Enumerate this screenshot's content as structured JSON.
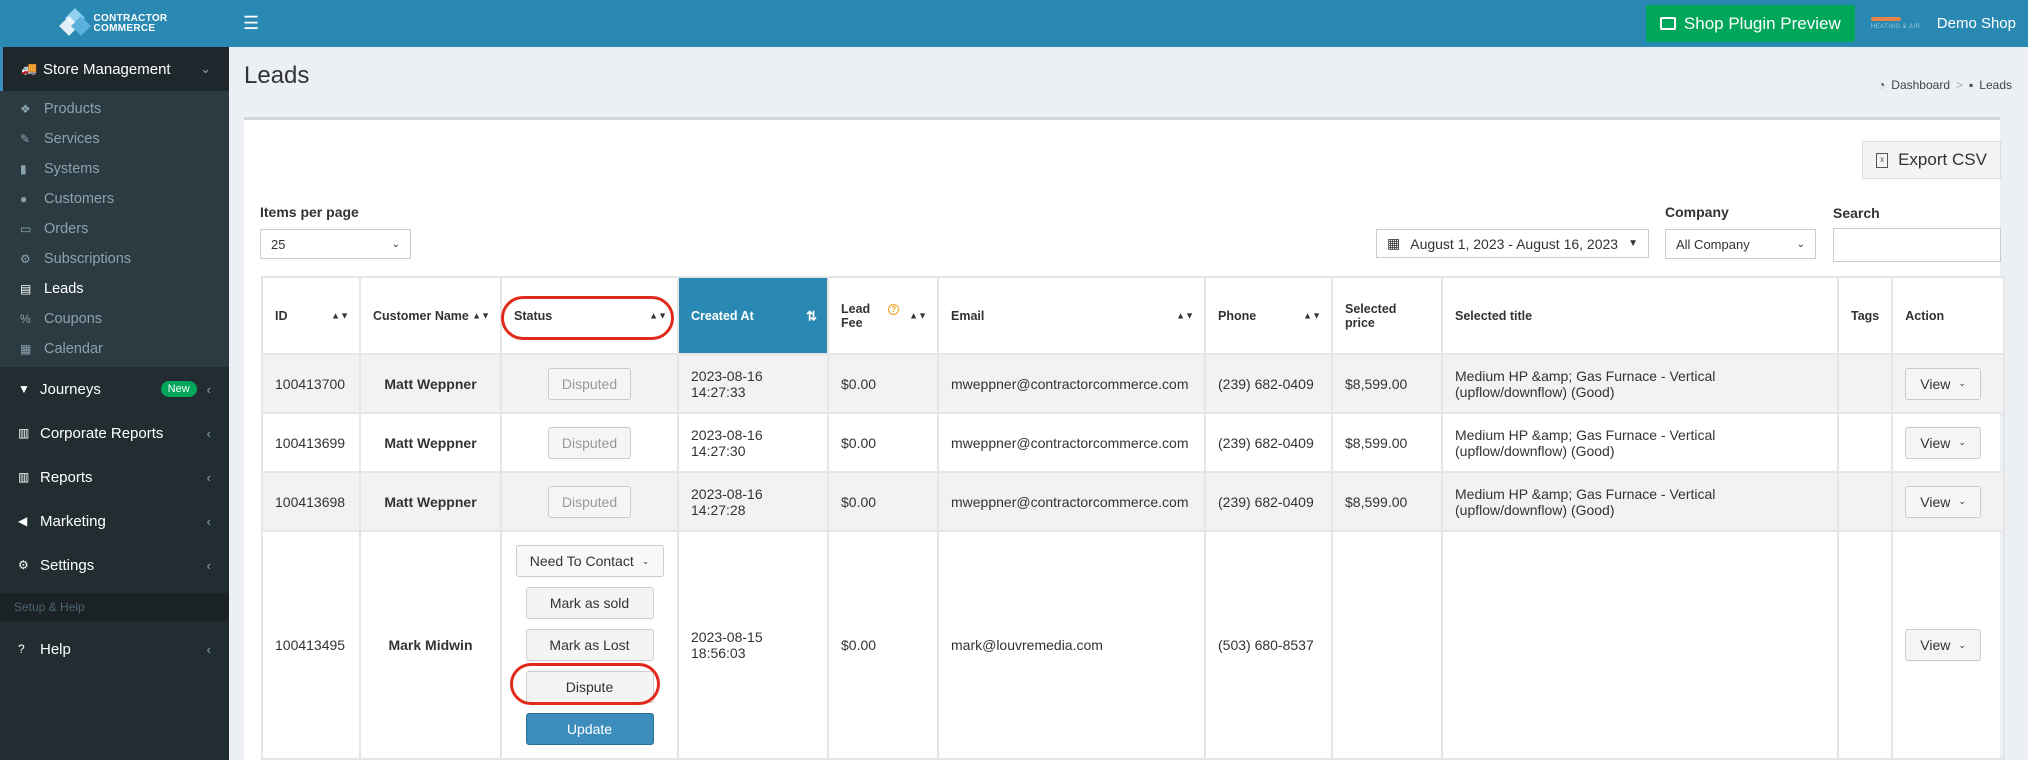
{
  "brand": {
    "line1": "CONTRACTOR",
    "line2": "COMMERCE"
  },
  "sidebar": {
    "store_management": "Store Management",
    "sub_items": [
      {
        "label": "Products",
        "icon": "cubes-icon"
      },
      {
        "label": "Services",
        "icon": "wrench-icon"
      },
      {
        "label": "Systems",
        "icon": "systems-icon"
      },
      {
        "label": "Customers",
        "icon": "users-icon"
      },
      {
        "label": "Orders",
        "icon": "inbox-icon"
      },
      {
        "label": "Subscriptions",
        "icon": "cogs-icon"
      },
      {
        "label": "Leads",
        "icon": "table-icon"
      },
      {
        "label": "Coupons",
        "icon": "percent-icon"
      },
      {
        "label": "Calendar",
        "icon": "calendar-icon"
      }
    ],
    "journeys": "Journeys",
    "journeys_badge": "New",
    "corporate_reports": "Corporate Reports",
    "reports": "Reports",
    "marketing": "Marketing",
    "settings": "Settings",
    "setup_help": "Setup & Help",
    "help": "Help"
  },
  "header": {
    "plugin_button": "Shop Plugin Preview",
    "shop_name": "Demo Shop",
    "logo_text": "HEATING & AIR"
  },
  "page": {
    "title": "Leads",
    "breadcrumb_dashboard": "Dashboard",
    "breadcrumb_current": "Leads"
  },
  "toolbar": {
    "export_label": "Export CSV",
    "items_per_page_label": "Items per page",
    "items_per_page_value": "25",
    "date_range": "August 1, 2023 - August 16, 2023",
    "company_label": "Company",
    "company_value": "All Company",
    "search_label": "Search"
  },
  "table": {
    "headers": {
      "id": "ID",
      "customer_name": "Customer Name",
      "status": "Status",
      "created_at": "Created At",
      "lead_fee_1": "Lead",
      "lead_fee_2": "Fee",
      "email": "Email",
      "phone": "Phone",
      "selected_price": "Selected price",
      "selected_title": "Selected title",
      "tags": "Tags",
      "action": "Action"
    },
    "rows": [
      {
        "id": "100413700",
        "customer": "Matt Weppner",
        "status": "Disputed",
        "date": "2023-08-16",
        "time": "14:27:33",
        "fee": "$0.00",
        "email": "mweppner@contractorcommerce.com",
        "phone": "(239) 682-0409",
        "price": "$8,599.00",
        "title1": "Medium HP &amp; Gas Furnace - Vertical",
        "title2": "(upflow/downflow) (Good)",
        "action": "View"
      },
      {
        "id": "100413699",
        "customer": "Matt Weppner",
        "status": "Disputed",
        "date": "2023-08-16",
        "time": "14:27:30",
        "fee": "$0.00",
        "email": "mweppner@contractorcommerce.com",
        "phone": "(239) 682-0409",
        "price": "$8,599.00",
        "title1": "Medium HP &amp; Gas Furnace - Vertical",
        "title2": "(upflow/downflow) (Good)",
        "action": "View"
      },
      {
        "id": "100413698",
        "customer": "Matt Weppner",
        "status": "Disputed",
        "date": "2023-08-16",
        "time": "14:27:28",
        "fee": "$0.00",
        "email": "mweppner@contractorcommerce.com",
        "phone": "(239) 682-0409",
        "price": "$8,599.00",
        "title1": "Medium HP &amp; Gas Furnace - Vertical",
        "title2": "(upflow/downflow) (Good)",
        "action": "View"
      },
      {
        "id": "100413495",
        "customer": "Mark Midwin",
        "status_select": "Need To Contact",
        "mark_sold": "Mark as sold",
        "mark_lost": "Mark as Lost",
        "dispute": "Dispute",
        "update": "Update",
        "date": "2023-08-15",
        "time": "18:56:03",
        "fee": "$0.00",
        "email": "mark@louvremedia.com",
        "phone": "(503) 680-8537",
        "action": "View"
      }
    ]
  },
  "colors": {
    "header_blue": "#2a89b3",
    "sidebar_dark": "#222d32",
    "green": "#00a65a",
    "highlight_red": "#e02a1c"
  }
}
